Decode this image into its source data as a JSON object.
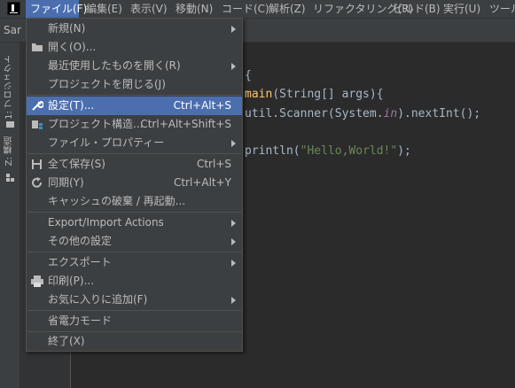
{
  "menubar": {
    "items": [
      "ファイル(F)",
      "編集(E)",
      "表示(V)",
      "移動(N)",
      "コード(C)",
      "解析(Z)",
      "リファクタリング(R)",
      "ビルド(B)",
      "実行(U)",
      "ツール"
    ]
  },
  "toolbar": {
    "tab_label": "Sar"
  },
  "side_panel": {
    "project_tab": "1: プロジェクト",
    "structure_tab": "Z: 構造"
  },
  "editor": {
    "lines": [
      {
        "pre": "",
        "fn": "",
        "post": "{",
        "str": "",
        "it": "",
        "tail": ""
      },
      {
        "pre": "",
        "fn": "main",
        "post": "(String[] args){",
        "str": "",
        "it": "",
        "tail": ""
      },
      {
        "pre": "util.Scanner(System.",
        "fn": "",
        "post": "",
        "str": "",
        "it": "in",
        "tail": ").nextInt();"
      },
      {
        "pre": "println(",
        "fn": "",
        "post": "",
        "str": "\"Hello,World!\"",
        "it": "",
        "tail": ");"
      }
    ]
  },
  "file_menu": {
    "items": [
      {
        "label": "新規(N)",
        "shortcut": "",
        "submenu": true,
        "icon": ""
      },
      {
        "label": "開く(O)...",
        "shortcut": "",
        "submenu": false,
        "icon": "folder-icon"
      },
      {
        "label": "最近使用したものを開く(R)",
        "shortcut": "",
        "submenu": true,
        "icon": ""
      },
      {
        "label": "プロジェクトを閉じる(J)",
        "shortcut": "",
        "submenu": false,
        "icon": ""
      },
      {
        "label": "設定(T)...",
        "shortcut": "Ctrl+Alt+S",
        "submenu": false,
        "icon": "wrench-icon",
        "selected": true
      },
      {
        "label": "プロジェクト構造...",
        "shortcut": "Ctrl+Alt+Shift+S",
        "submenu": false,
        "icon": "project-structure-icon"
      },
      {
        "label": "ファイル・プロパティー",
        "shortcut": "",
        "submenu": true,
        "icon": ""
      },
      {
        "label": "全て保存(S)",
        "shortcut": "Ctrl+S",
        "submenu": false,
        "icon": "save-icon"
      },
      {
        "label": "同期(Y)",
        "shortcut": "Ctrl+Alt+Y",
        "submenu": false,
        "icon": "sync-icon"
      },
      {
        "label": "キャッシュの破棄 / 再起動...",
        "shortcut": "",
        "submenu": false,
        "icon": ""
      },
      {
        "label": "Export/Import Actions",
        "shortcut": "",
        "submenu": true,
        "icon": ""
      },
      {
        "label": "その他の設定",
        "shortcut": "",
        "submenu": true,
        "icon": ""
      },
      {
        "label": "エクスポート",
        "shortcut": "",
        "submenu": true,
        "icon": ""
      },
      {
        "label": "印刷(P)...",
        "shortcut": "",
        "submenu": false,
        "icon": "print-icon"
      },
      {
        "label": "お気に入りに追加(F)",
        "shortcut": "",
        "submenu": true,
        "icon": ""
      },
      {
        "label": "省電力モード",
        "shortcut": "",
        "submenu": false,
        "icon": ""
      },
      {
        "label": "終了(X)",
        "shortcut": "",
        "submenu": false,
        "icon": ""
      }
    ]
  },
  "colors": {
    "accent": "#4b6eaf",
    "menu_bg": "#3c3f41",
    "editor_bg": "#2b2b2b"
  }
}
